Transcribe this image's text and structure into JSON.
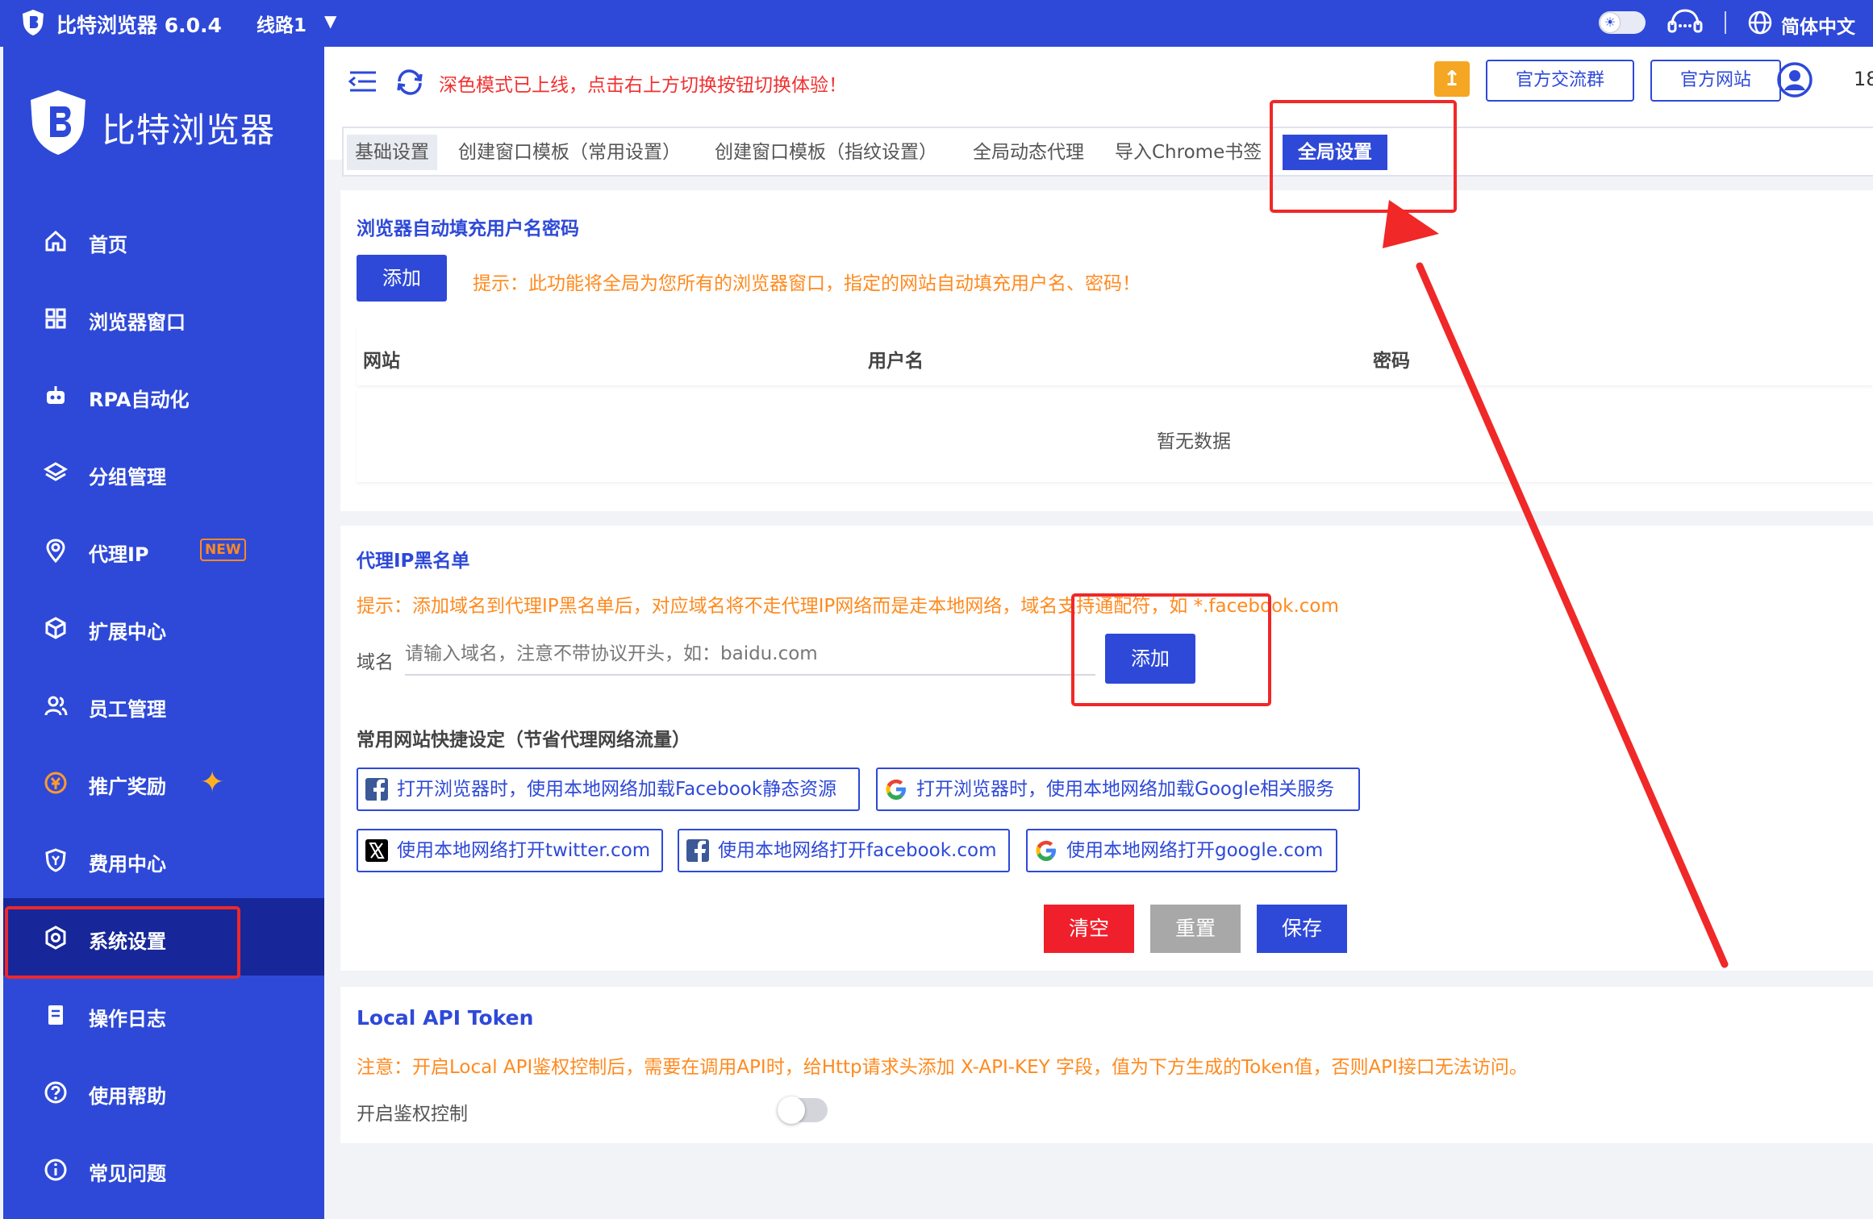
{
  "titlebar": {
    "app_title": "比特浏览器 6.0.4",
    "line": "线路1",
    "language": "简体中文"
  },
  "sidebar": {
    "brand": "比特浏览器",
    "items": [
      {
        "label": "首页",
        "icon": "home-icon"
      },
      {
        "label": "浏览器窗口",
        "icon": "grid-icon"
      },
      {
        "label": "RPA自动化",
        "icon": "robot-icon"
      },
      {
        "label": "分组管理",
        "icon": "layers-icon"
      },
      {
        "label": "代理IP",
        "icon": "location-icon",
        "badge": "NEW"
      },
      {
        "label": "扩展中心",
        "icon": "cube-icon"
      },
      {
        "label": "员工管理",
        "icon": "users-icon"
      },
      {
        "label": "推广奖励",
        "icon": "coin-icon"
      },
      {
        "label": "费用中心",
        "icon": "shield-icon"
      },
      {
        "label": "系统设置",
        "icon": "settings-icon",
        "active": true
      },
      {
        "label": "操作日志",
        "icon": "log-icon"
      },
      {
        "label": "使用帮助",
        "icon": "help-icon"
      },
      {
        "label": "常见问题",
        "icon": "info-icon"
      }
    ]
  },
  "header": {
    "notice": "深色模式已上线，点击右上方切换按钮切换体验！",
    "btn_group": "官方交流群",
    "btn_site": "官方网站",
    "user_id": "18"
  },
  "tabs": [
    {
      "label": "基础设置"
    },
    {
      "label": "创建窗口模板（常用设置）"
    },
    {
      "label": "创建窗口模板（指纹设置）"
    },
    {
      "label": "全局动态代理"
    },
    {
      "label": "导入Chrome书签"
    },
    {
      "label": "全局设置",
      "active": true
    }
  ],
  "autofill": {
    "title": "浏览器自动填充用户名密码",
    "add_label": "添加",
    "hint": "提示：此功能将全局为您所有的浏览器窗口，指定的网站自动填充用户名、密码！",
    "columns": [
      "网站",
      "用户名",
      "密码"
    ],
    "empty": "暂无数据"
  },
  "blacklist": {
    "title": "代理IP黑名单",
    "hint": "提示：添加域名到代理IP黑名单后，对应域名将不走代理IP网络而是走本地网络，域名支持通配符，如 *.facebook.com",
    "domain_label": "域名",
    "domain_placeholder": "请输入域名，注意不带协议开头，如：baidu.com",
    "add_label": "添加",
    "quick_title": "常用网站快捷设定（节省代理网络流量）",
    "quick": [
      {
        "label": "打开浏览器时，使用本地网络加载Facebook静态资源",
        "icon": "facebook-icon"
      },
      {
        "label": "打开浏览器时，使用本地网络加载Google相关服务",
        "icon": "google-icon"
      },
      {
        "label": "使用本地网络打开twitter.com",
        "icon": "x-twitter-icon"
      },
      {
        "label": "使用本地网络打开facebook.com",
        "icon": "facebook-icon"
      },
      {
        "label": "使用本地网络打开google.com",
        "icon": "google-icon"
      }
    ],
    "clear_label": "清空",
    "reset_label": "重置",
    "save_label": "保存"
  },
  "api_token": {
    "title": "Local API Token",
    "notice": "注意：开启Local API鉴权控制后，需要在调用API时，给Http请求头添加 X-API-KEY 字段，值为下方生成的Token值，否则API接口无法访问。",
    "toggle_label": "开启鉴权控制",
    "enabled": false
  },
  "colors": {
    "brand_blue": "#2e49d8",
    "sidebar_active": "#172799",
    "hint_orange": "#ff8a1e",
    "notice_red": "#f23030",
    "annotation_red": "#f02828"
  }
}
